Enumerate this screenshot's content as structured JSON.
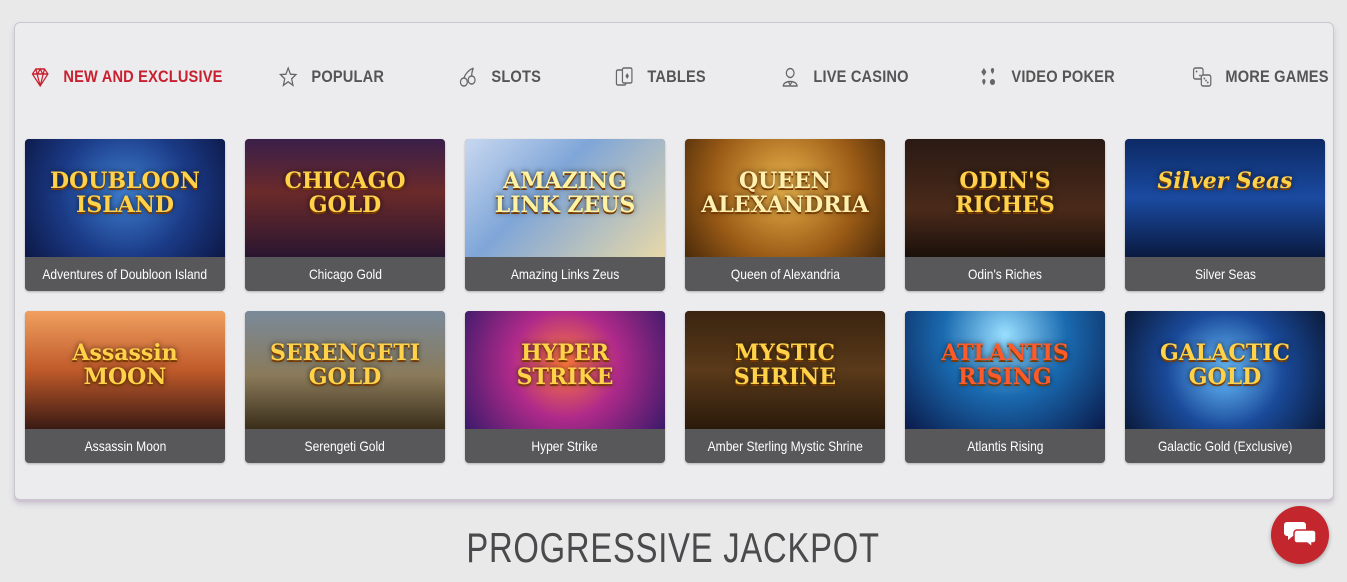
{
  "tabs": [
    {
      "label": "NEW AND EXCLUSIVE",
      "icon": "diamond-icon",
      "active": true
    },
    {
      "label": "POPULAR",
      "icon": "star-icon",
      "active": false
    },
    {
      "label": "SLOTS",
      "icon": "cherries-icon",
      "active": false
    },
    {
      "label": "TABLES",
      "icon": "cards-icon",
      "active": false
    },
    {
      "label": "LIVE CASINO",
      "icon": "dealer-icon",
      "active": false
    },
    {
      "label": "VIDEO POKER",
      "icon": "suits-icon",
      "active": false
    },
    {
      "label": "MORE GAMES",
      "icon": "dice-icon",
      "active": false
    }
  ],
  "games": [
    {
      "title": "Adventures of Doubloon Island",
      "logo": "DOUBLOON ISLAND"
    },
    {
      "title": "Chicago Gold",
      "logo": "CHICAGO GOLD"
    },
    {
      "title": "Amazing Links Zeus",
      "logo": "AMAZING LINK ZEUS"
    },
    {
      "title": "Queen of Alexandria",
      "logo": "QUEEN ALEXANDRIA"
    },
    {
      "title": "Odin's Riches",
      "logo": "ODIN'S RICHES"
    },
    {
      "title": "Silver Seas",
      "logo": "Silver Seas"
    },
    {
      "title": "Assassin Moon",
      "logo": "Assassin MOON"
    },
    {
      "title": "Serengeti Gold",
      "logo": "SERENGETI GOLD"
    },
    {
      "title": "Hyper Strike",
      "logo": "HYPER STRIKE"
    },
    {
      "title": "Amber Sterling Mystic Shrine",
      "logo": "MYSTIC SHRINE"
    },
    {
      "title": "Atlantis Rising",
      "logo": "ATLANTIS RISING"
    },
    {
      "title": "Galactic Gold (Exclusive)",
      "logo": "GALACTIC GOLD"
    }
  ],
  "section_title": "PROGRESSIVE JACKPOT",
  "colors": {
    "accent": "#c8202f",
    "card_caption_bg": "#58585b",
    "chat_button": "#c4262e"
  }
}
